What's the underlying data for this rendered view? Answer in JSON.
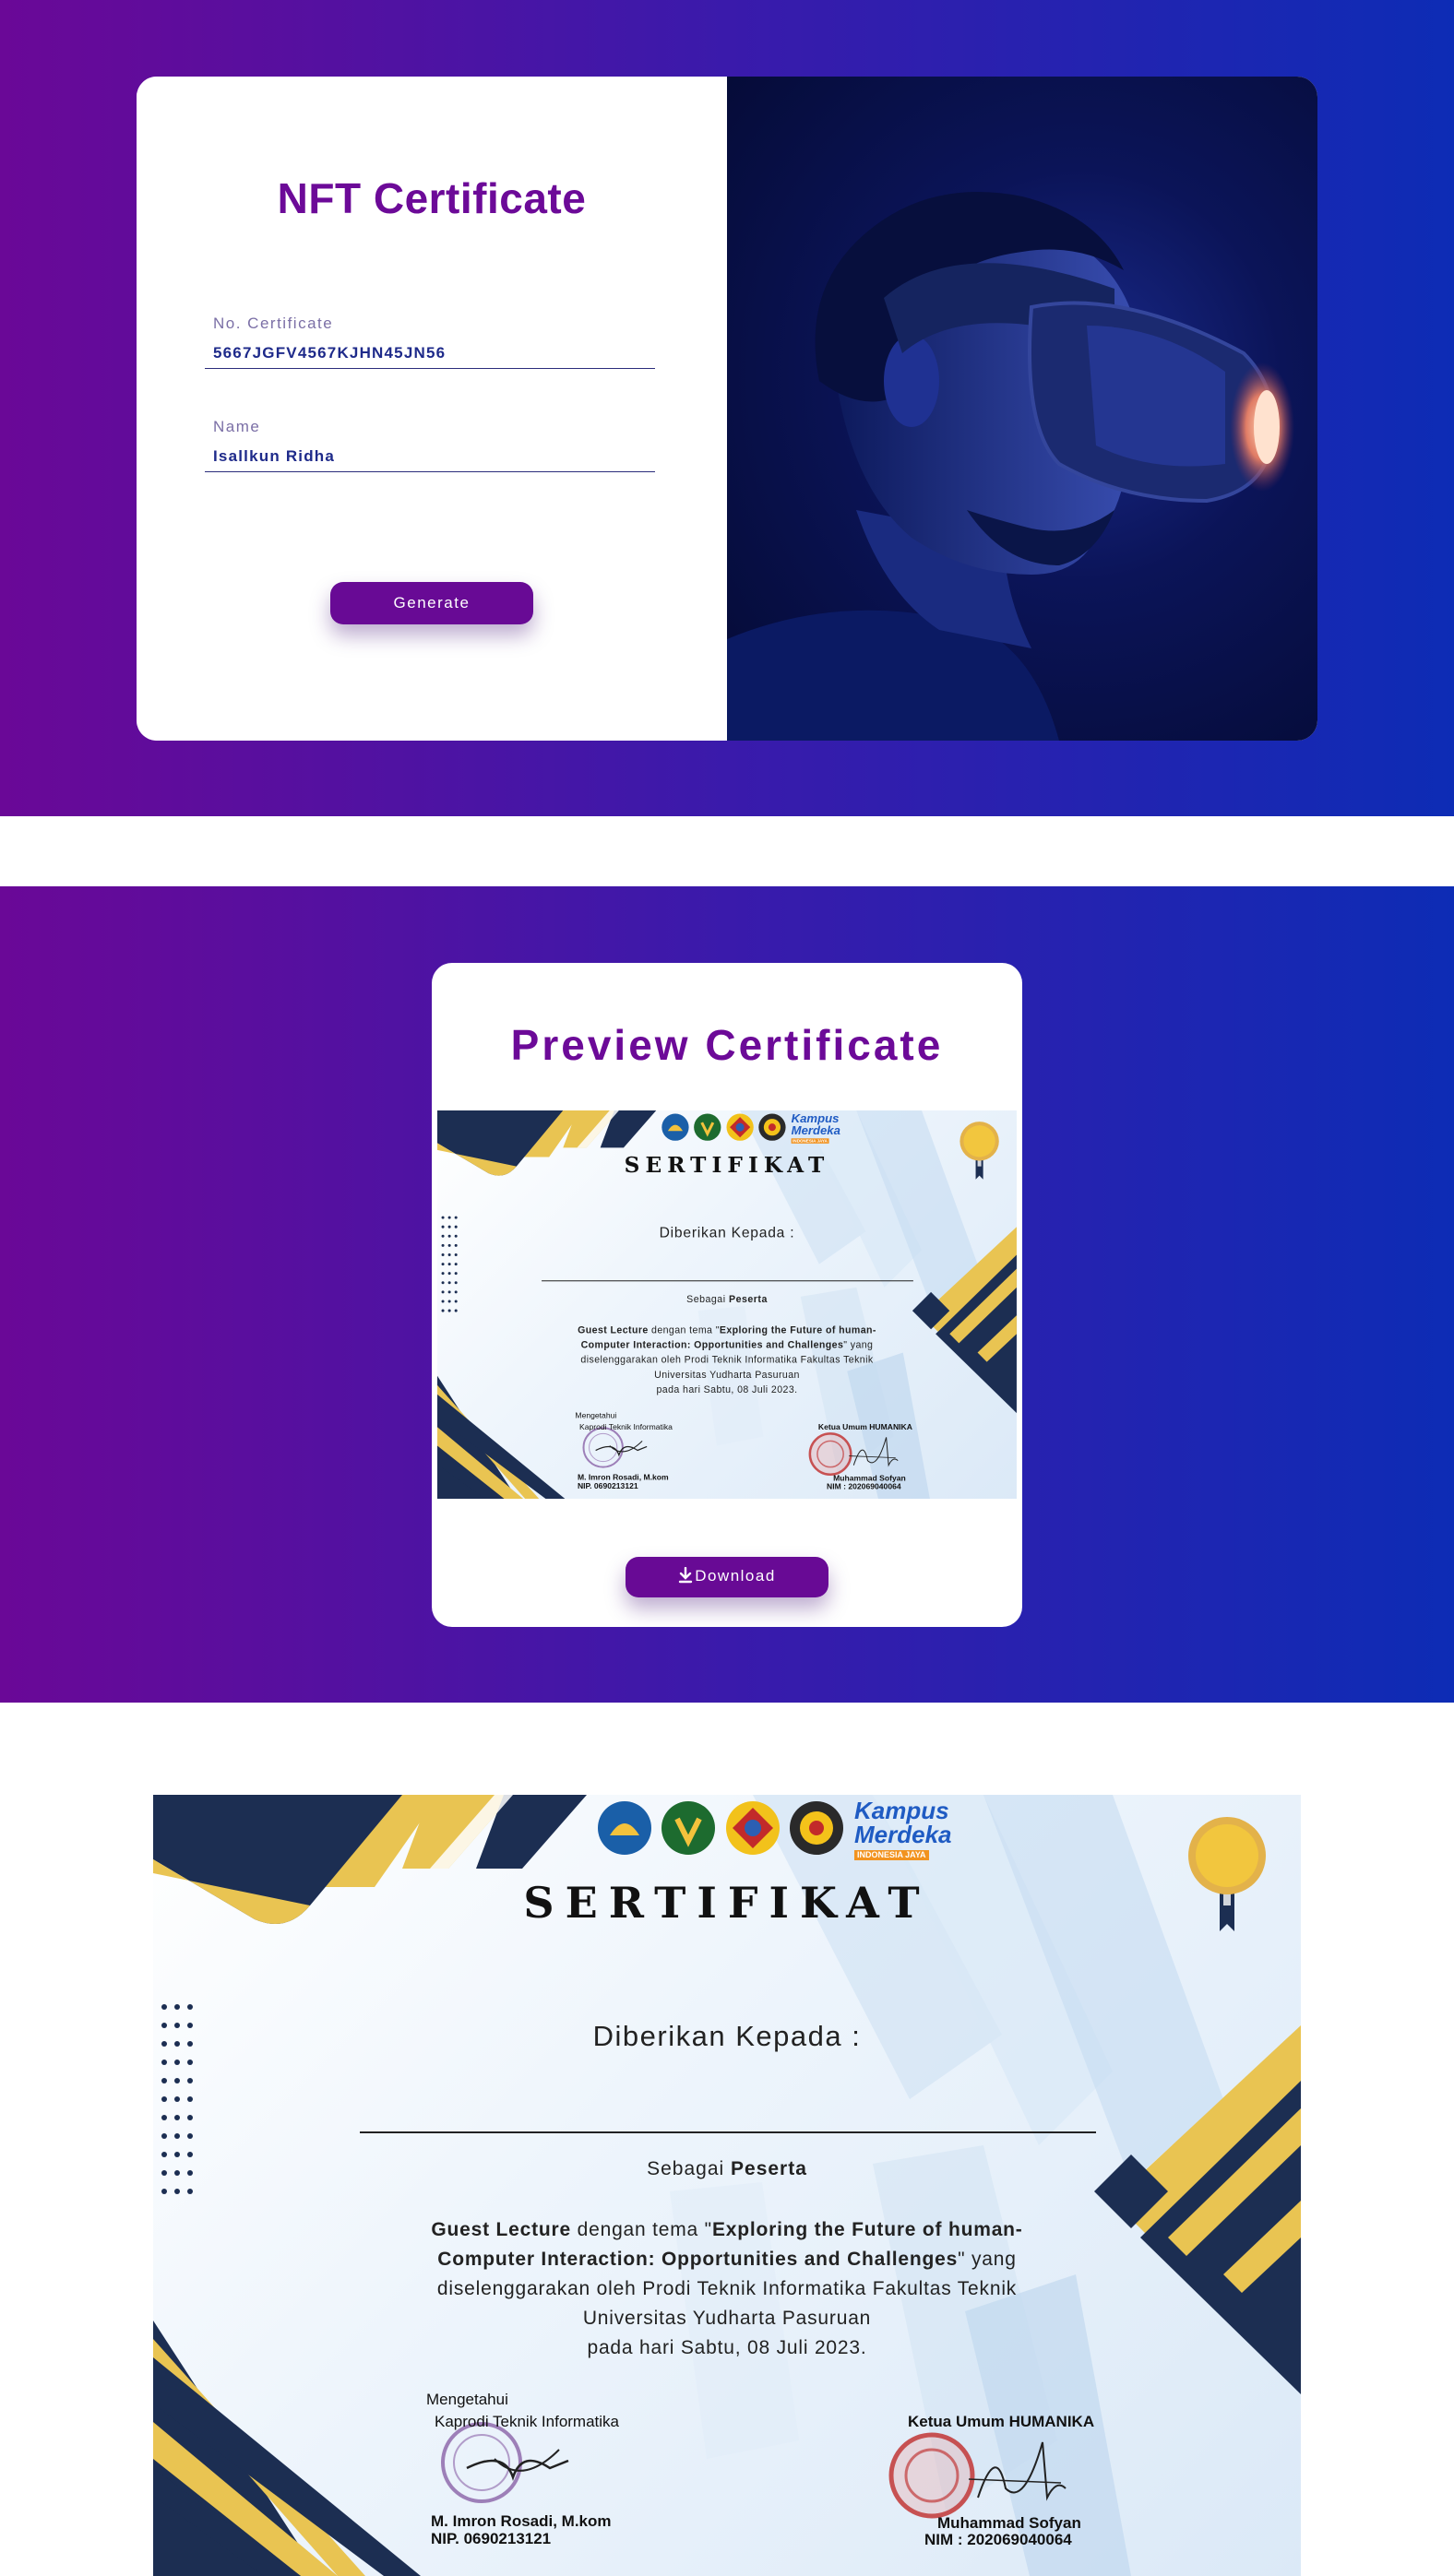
{
  "form": {
    "title": "NFT Certificate",
    "certificate_label": "No. Certificate",
    "certificate_value": "5667JGFV4567KJHN45JN56",
    "name_label": "Name",
    "name_value": "Isallkun Ridha",
    "generate_label": "Generate"
  },
  "preview": {
    "title": "Preview Certificate",
    "download_label": "Download"
  },
  "certificate": {
    "logo_text_line1": "Kampus",
    "logo_text_line2": "Merdeka",
    "logo_text_line3": "INDONESIA JAYA",
    "title": "SERTIFIKAT",
    "given_to": "Diberikan Kepada :",
    "role_prefix": "Sebagai",
    "role": "Peserta",
    "event_type": "Guest Lecture",
    "theme_prefix": "dengan tema \"",
    "theme": "Exploring the Future of human-Computer Interaction: Opportunities and Challenges",
    "theme_suffix": "\" yang",
    "organizer": "diselenggarakan oleh Prodi Teknik Informatika Fakultas Teknik Universitas Yudharta Pasuruan",
    "date": "pada hari Sabtu, 08 Juli 2023.",
    "acknowledge_label": "Mengetahui",
    "left_signer_title": "Kaprodi Teknik Informatika",
    "left_signer_name": "M. Imron Rosadi, M.kom",
    "left_signer_id": "NIP. 0690213121",
    "right_signer_title": "Ketua Umum HUMANIKA",
    "right_signer_name": "Muhammad Sofyan",
    "right_signer_id": "NIM : 202069040064"
  },
  "colors": {
    "brand_purple": "#680a95",
    "gradient_start": "#6a0897",
    "gradient_end": "#0d2cb5",
    "navy": "#1c2e52",
    "gold": "#e8c351"
  }
}
